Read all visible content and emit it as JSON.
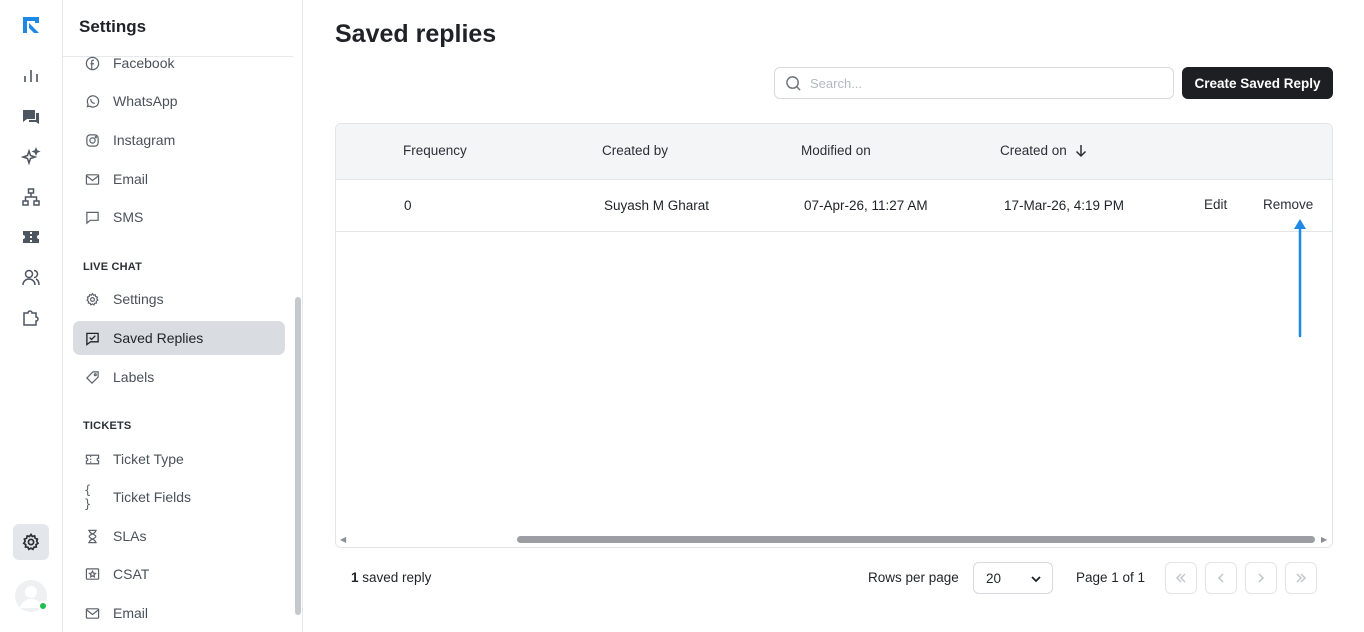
{
  "app": {
    "brand_color": "#1e88e5",
    "rail_icons": [
      "analytics-icon",
      "chat-icon",
      "sparkles-icon",
      "org-chart-icon",
      "ticket-icon",
      "users-icon",
      "puzzle-icon",
      "gear-icon"
    ],
    "online_status_color": "#1fbf4b"
  },
  "sidebar": {
    "title": "Settings",
    "channels": [
      {
        "label": "Facebook",
        "icon": "facebook-icon"
      },
      {
        "label": "WhatsApp",
        "icon": "whatsapp-icon"
      },
      {
        "label": "Instagram",
        "icon": "instagram-icon"
      },
      {
        "label": "Email",
        "icon": "mail-icon"
      },
      {
        "label": "SMS",
        "icon": "message-square-icon"
      }
    ],
    "live_chat_heading": "LIVE CHAT",
    "live_chat": [
      {
        "label": "Settings",
        "icon": "gear-icon"
      },
      {
        "label": "Saved Replies",
        "icon": "saved-reply-icon",
        "active": true
      },
      {
        "label": "Labels",
        "icon": "tag-icon"
      }
    ],
    "tickets_heading": "TICKETS",
    "tickets": [
      {
        "label": "Ticket Type",
        "icon": "ticket-icon"
      },
      {
        "label": "Ticket Fields",
        "icon": "braces-icon"
      },
      {
        "label": "SLAs",
        "icon": "hourglass-icon"
      },
      {
        "label": "CSAT",
        "icon": "star-box-icon"
      },
      {
        "label": "Email",
        "icon": "mail-icon"
      }
    ]
  },
  "main": {
    "title": "Saved replies",
    "search": {
      "placeholder": "Search...",
      "value": ""
    },
    "create_button": "Create Saved Reply",
    "table": {
      "columns": [
        "Frequency",
        "Created by",
        "Modified on",
        "Created on"
      ],
      "sorted_column": "Created on",
      "sort_direction": "descending",
      "rows": [
        {
          "frequency": "0",
          "created_by": "Suyash M Gharat",
          "modified_on": "07-Apr-26, 11:27 AM",
          "created_on": "17-Mar-26, 4:19 PM",
          "edit": "Edit",
          "remove": "Remove"
        }
      ]
    },
    "footer": {
      "count_number": "1",
      "count_label": "saved reply",
      "rows_per_page_label": "Rows per page",
      "rows_per_page_value": "20",
      "page_info": "Page 1 of 1"
    },
    "annotation_color": "#1e88e5"
  }
}
